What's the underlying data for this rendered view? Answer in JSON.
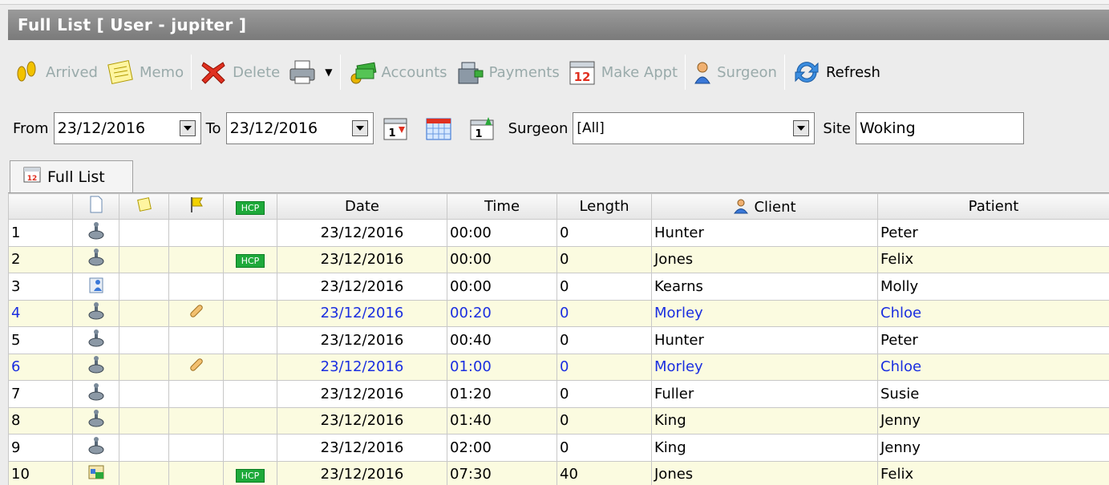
{
  "window": {
    "title": "Full List  [ User - jupiter ]"
  },
  "toolbar": {
    "arrived": {
      "label": "Arrived",
      "icon": "footprints-icon"
    },
    "memo": {
      "label": "Memo",
      "icon": "memo-icon"
    },
    "delete": {
      "label": "Delete",
      "icon": "delete-x-icon"
    },
    "print": {
      "icon": "printer-icon"
    },
    "accounts": {
      "label": "Accounts",
      "icon": "money-icon"
    },
    "payments": {
      "label": "Payments",
      "icon": "cash-register-icon"
    },
    "make_appt": {
      "label": "Make Appt",
      "icon": "calendar-12-icon"
    },
    "surgeon": {
      "label": "Surgeon",
      "icon": "surgeon-icon"
    },
    "refresh": {
      "label": "Refresh",
      "icon": "refresh-icon"
    }
  },
  "filters": {
    "from_label": "From",
    "from_value": "23/12/2016",
    "to_label": "To",
    "to_value": "23/12/2016",
    "surgeon_label": "Surgeon",
    "surgeon_value": "[All]",
    "site_label": "Site",
    "site_value": "Woking"
  },
  "tab": {
    "label": "Full List"
  },
  "table": {
    "columns": [
      "",
      "",
      "",
      "",
      "HCP",
      "Date",
      "Time",
      "Length",
      "Client",
      "Patient"
    ],
    "rows": [
      {
        "num": "1",
        "hcp": "",
        "date": "23/12/2016",
        "time": "00:00",
        "length": "0",
        "client": "Hunter",
        "patient": "Peter"
      },
      {
        "num": "2",
        "hcp": "HCP",
        "date": "23/12/2016",
        "time": "00:00",
        "length": "0",
        "client": "Jones",
        "patient": "Felix"
      },
      {
        "num": "3",
        "hcp": "",
        "date": "23/12/2016",
        "time": "00:00",
        "length": "0",
        "client": "Kearns",
        "patient": "Molly"
      },
      {
        "num": "4",
        "hcp": "",
        "date": "23/12/2016",
        "time": "00:20",
        "length": "0",
        "client": "Morley",
        "patient": "Chloe"
      },
      {
        "num": "5",
        "hcp": "",
        "date": "23/12/2016",
        "time": "00:40",
        "length": "0",
        "client": "Hunter",
        "patient": "Peter"
      },
      {
        "num": "6",
        "hcp": "",
        "date": "23/12/2016",
        "time": "01:00",
        "length": "0",
        "client": "Morley",
        "patient": "Chloe"
      },
      {
        "num": "7",
        "hcp": "",
        "date": "23/12/2016",
        "time": "01:20",
        "length": "0",
        "client": "Fuller",
        "patient": "Susie"
      },
      {
        "num": "8",
        "hcp": "",
        "date": "23/12/2016",
        "time": "01:40",
        "length": "0",
        "client": "King",
        "patient": "Jenny"
      },
      {
        "num": "9",
        "hcp": "",
        "date": "23/12/2016",
        "time": "02:00",
        "length": "0",
        "client": "King",
        "patient": "Jenny"
      },
      {
        "num": "10",
        "hcp": "HCP",
        "date": "23/12/2016",
        "time": "07:30",
        "length": "40",
        "client": "Jones",
        "patient": "Felix"
      }
    ]
  }
}
